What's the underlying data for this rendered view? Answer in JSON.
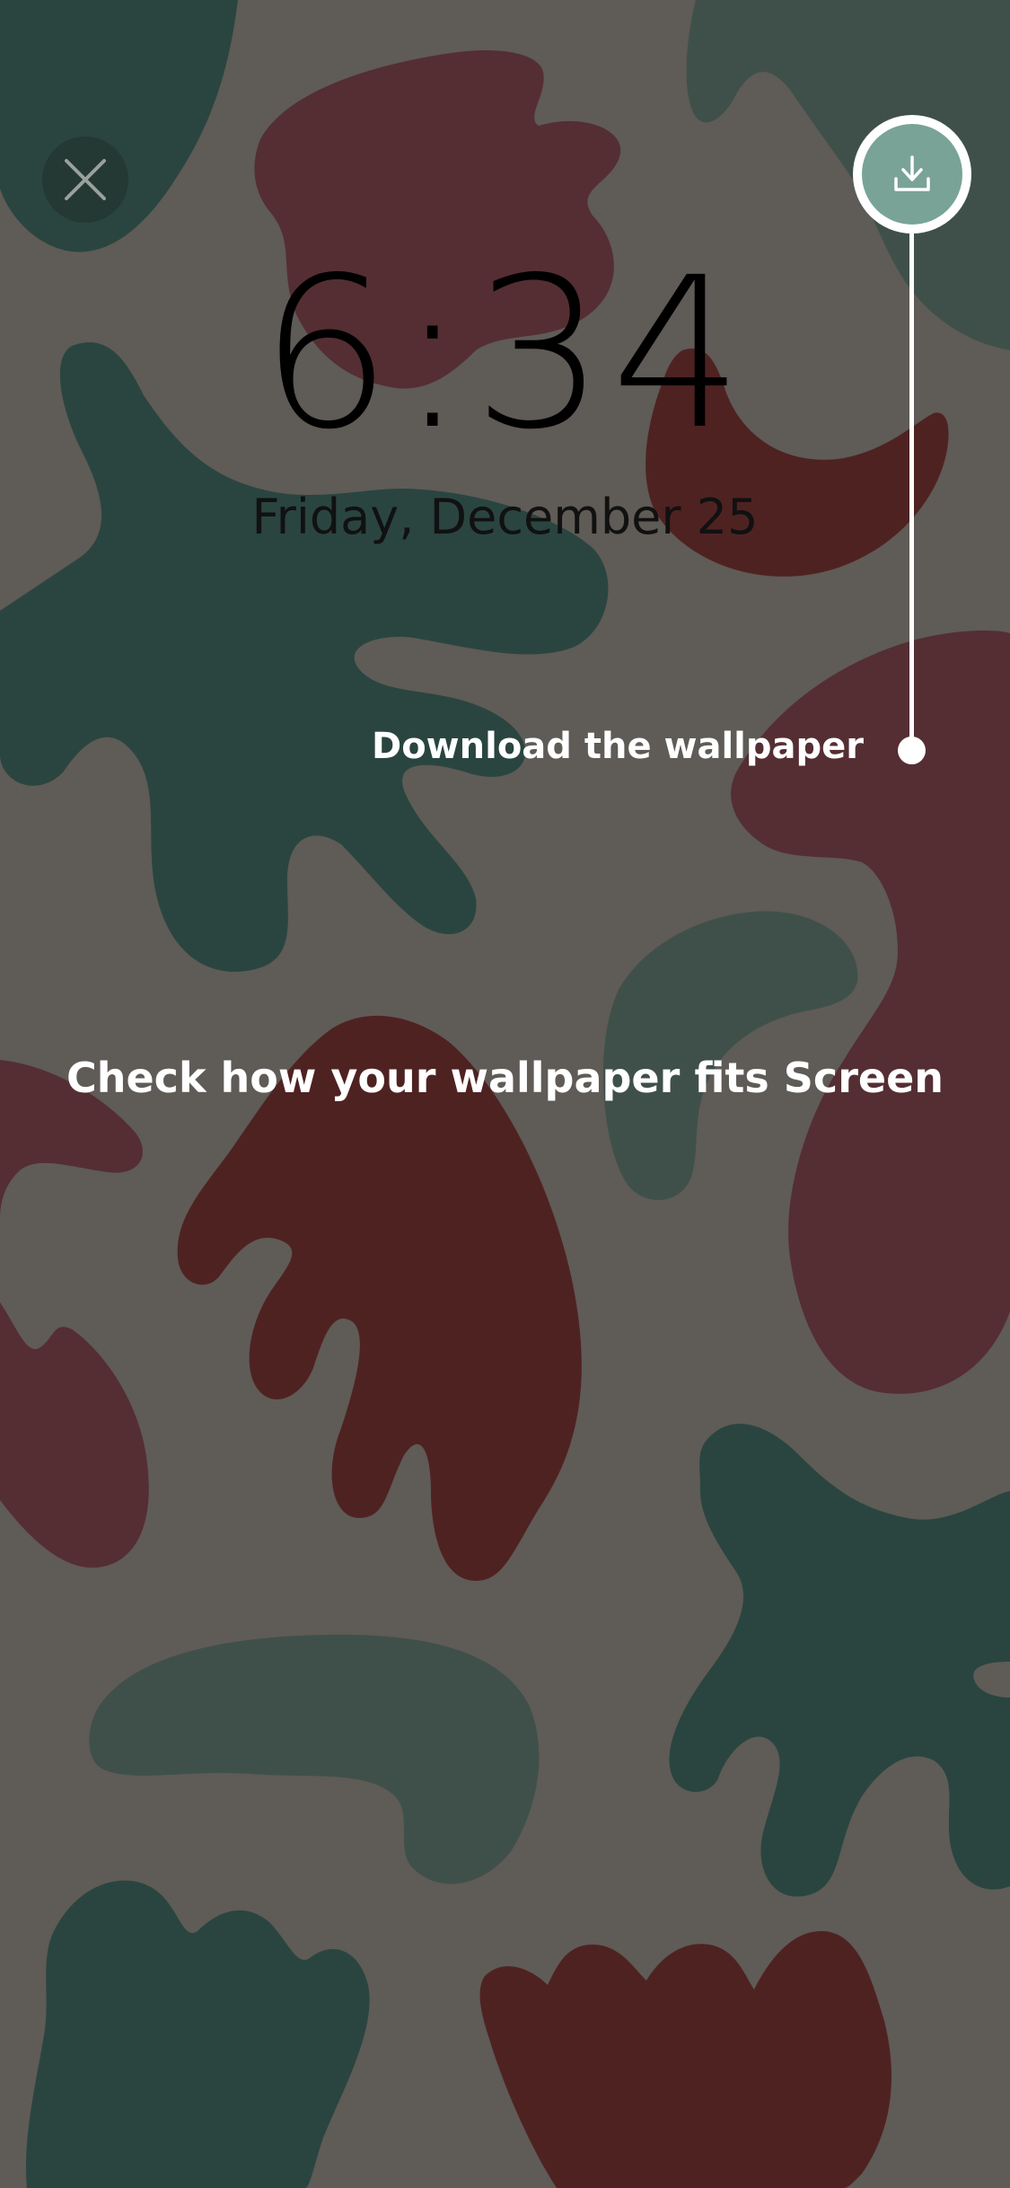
{
  "lock_screen": {
    "time": "6:34",
    "date": "Friday, December 25"
  },
  "controls": {
    "close_icon": "close-icon",
    "download_icon": "download-icon"
  },
  "coach_marks": {
    "download_tip": "Download the wallpaper",
    "preview_hint": "Check how your wallpaper fits Screen"
  },
  "colors": {
    "background": "#5f5b56",
    "blob_green": "#2a4540",
    "blob_gray_green": "#3f504a",
    "blob_maroon": "#542e33",
    "blob_red": "#4f2222",
    "download_accent": "#7aa398"
  }
}
